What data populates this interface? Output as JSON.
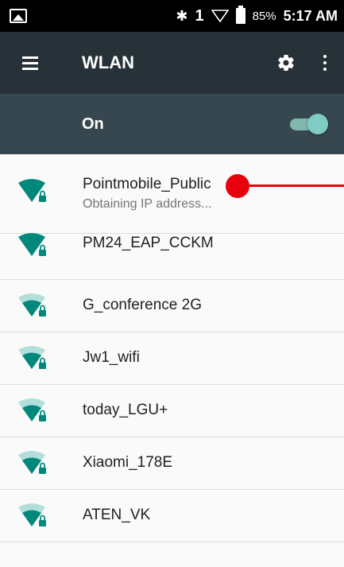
{
  "status_bar": {
    "bluetooth_glyph": "✱",
    "sim_number": "1",
    "battery_percent": "85%",
    "time": "5:17 AM",
    "icons": [
      "image-icon",
      "bluetooth-icon",
      "wifi-outline-icon",
      "battery-icon"
    ]
  },
  "app_bar": {
    "title": "WLAN",
    "icons": [
      "menu-icon",
      "gear-icon",
      "more-icon"
    ]
  },
  "toggle": {
    "label": "On",
    "state": true
  },
  "networks": [
    {
      "ssid": "Pointmobile_Public",
      "status": "Obtaining IP address...",
      "signal": 4,
      "locked": true
    },
    {
      "ssid": "PM24_EAP_CCKM",
      "signal": 4,
      "locked": true
    },
    {
      "ssid": "G_conference 2G",
      "signal": 3,
      "locked": true
    },
    {
      "ssid": "Jw1_wifi",
      "signal": 3,
      "locked": true
    },
    {
      "ssid": "today_LGU+",
      "signal": 3,
      "locked": true
    },
    {
      "ssid": "Xiaomi_178E",
      "signal": 3,
      "locked": true
    },
    {
      "ssid": "ATEN_VK",
      "signal": 3,
      "locked": true
    }
  ],
  "colors": {
    "wifi_strong": "#00897b",
    "wifi_weak": "#b2dfdb",
    "app_bar": "#263238",
    "toggle_bar": "#37474f",
    "touch_indicator": "#e8000b"
  }
}
